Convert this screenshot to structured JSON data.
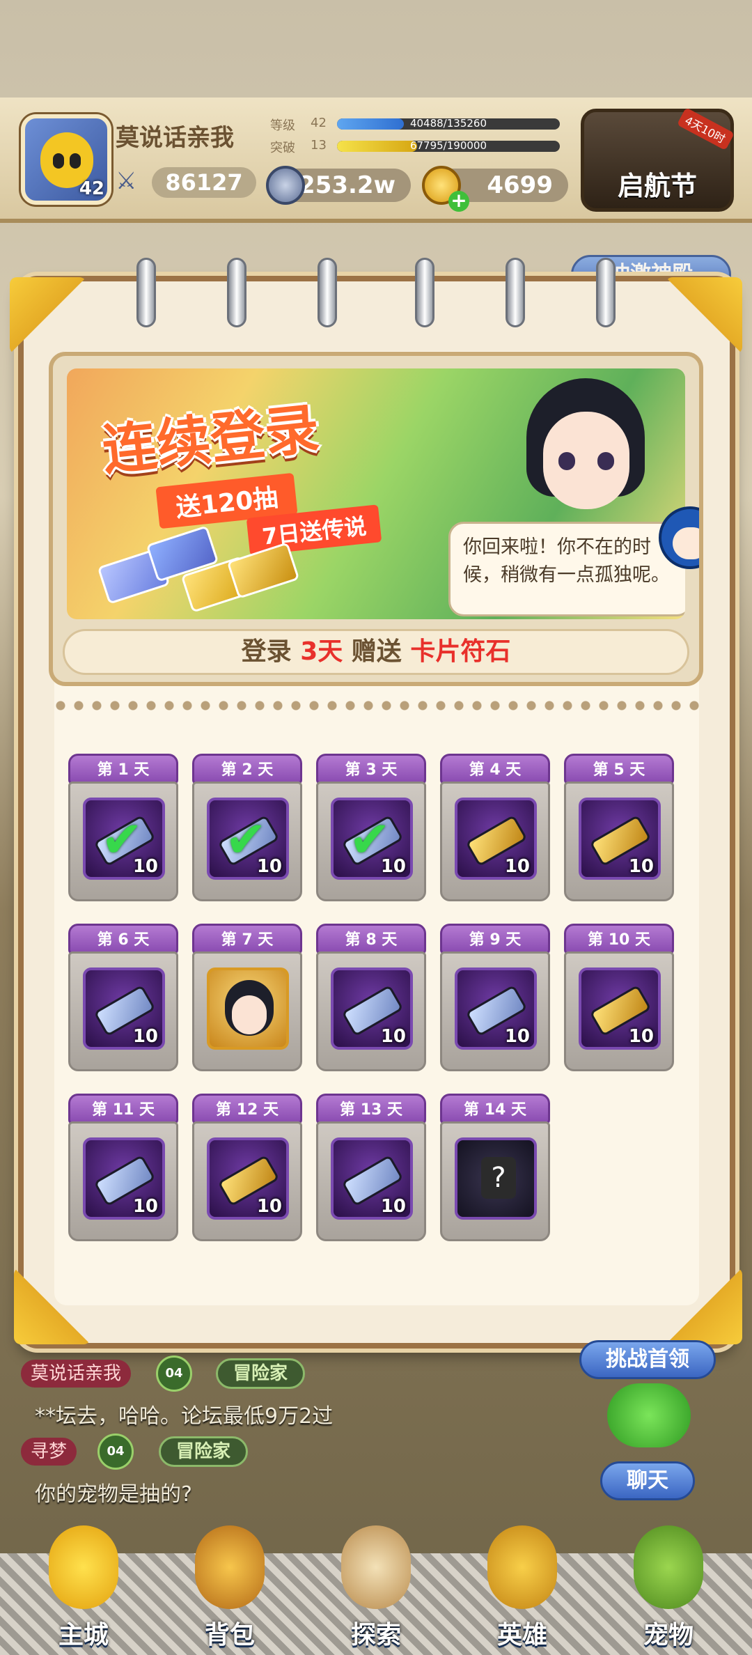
{
  "player": {
    "name": "莫说话亲我",
    "avatar_level": "42",
    "power": "86127",
    "level_label": "等级",
    "level_value": "42",
    "level_exp": "40488/135260",
    "level_progress": 0.3,
    "break_label": "突破",
    "break_value": "13",
    "break_exp": "67795/190000",
    "break_progress": 0.36
  },
  "currency": {
    "silver": "253.2w",
    "gold": "4699"
  },
  "event": {
    "label": "启航节",
    "tag": "4天10时"
  },
  "banner": {
    "title": "连续登录",
    "ribbon1": "送120抽",
    "ribbon2": "7日送传说",
    "speech": "你回来啦！你不在的时候，稍微有一点孤独呢。",
    "footer_pre": "登录",
    "footer_days": "3天",
    "footer_mid": "赠送",
    "footer_reward": "卡片符石"
  },
  "rewards": [
    {
      "day": "第 1 天",
      "count": "10",
      "type": "blue",
      "claimed": true
    },
    {
      "day": "第 2 天",
      "count": "10",
      "type": "blue",
      "claimed": true
    },
    {
      "day": "第 3 天",
      "count": "10",
      "type": "blue",
      "claimed": true
    },
    {
      "day": "第 4 天",
      "count": "10",
      "type": "gold",
      "claimed": false
    },
    {
      "day": "第 5 天",
      "count": "10",
      "type": "gold",
      "claimed": false
    },
    {
      "day": "第 6 天",
      "count": "10",
      "type": "blue",
      "claimed": false
    },
    {
      "day": "第 7 天",
      "count": "",
      "type": "hero",
      "claimed": false
    },
    {
      "day": "第 8 天",
      "count": "10",
      "type": "blue",
      "claimed": false
    },
    {
      "day": "第 9 天",
      "count": "10",
      "type": "blue",
      "claimed": false
    },
    {
      "day": "第 10 天",
      "count": "10",
      "type": "gold",
      "claimed": false
    },
    {
      "day": "第 11 天",
      "count": "10",
      "type": "blue",
      "claimed": false
    },
    {
      "day": "第 12 天",
      "count": "10",
      "type": "gold",
      "claimed": false
    },
    {
      "day": "第 13 天",
      "count": "10",
      "type": "blue",
      "claimed": false
    },
    {
      "day": "第 14 天",
      "count": "",
      "type": "mystery",
      "claimed": false
    }
  ],
  "chat": {
    "msg1_name": "莫说话亲我",
    "msg1_badge": "04",
    "msg1_tag": "冒险家",
    "msg1_text": "**坛去，哈哈。论坛最低9万2过",
    "msg2_name": "寻梦",
    "msg2_badge": "04",
    "msg2_tag": "冒险家",
    "msg2_text": "你的宠物是抽的?",
    "challenge_btn": "挑战首领",
    "chat_btn": "聊天",
    "partial_top_btn": "冲激神殿"
  },
  "nav": {
    "home": "主城",
    "bag": "背包",
    "explore": "探索",
    "hero": "英雄",
    "pet": "宠物"
  },
  "colors": {
    "accent_red": "#e8302b",
    "panel_purple": "#8a4cb1",
    "check_green": "#37d84b"
  }
}
